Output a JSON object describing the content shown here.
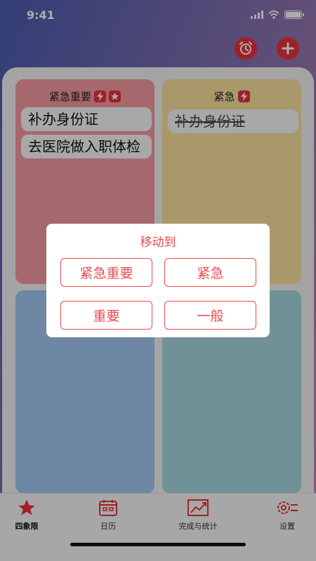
{
  "status": {
    "time": "9:41"
  },
  "quadrants": {
    "q1": {
      "title": "紧急重要",
      "tasks": [
        "补办身份证",
        "去医院做入职体检"
      ]
    },
    "q2": {
      "title": "紧急",
      "tasks": [
        "补办身份证"
      ]
    }
  },
  "dialog": {
    "title": "移动到",
    "options": [
      "紧急重要",
      "紧急",
      "重要",
      "一般"
    ]
  },
  "tabs": [
    "四象限",
    "日历",
    "完成与统计",
    "设置"
  ],
  "colors": {
    "accent": "#e7313a",
    "q1": "#f59aa1",
    "q2": "#f8e09d",
    "q3": "#a3c7ef",
    "q4": "#a5d6dd"
  }
}
